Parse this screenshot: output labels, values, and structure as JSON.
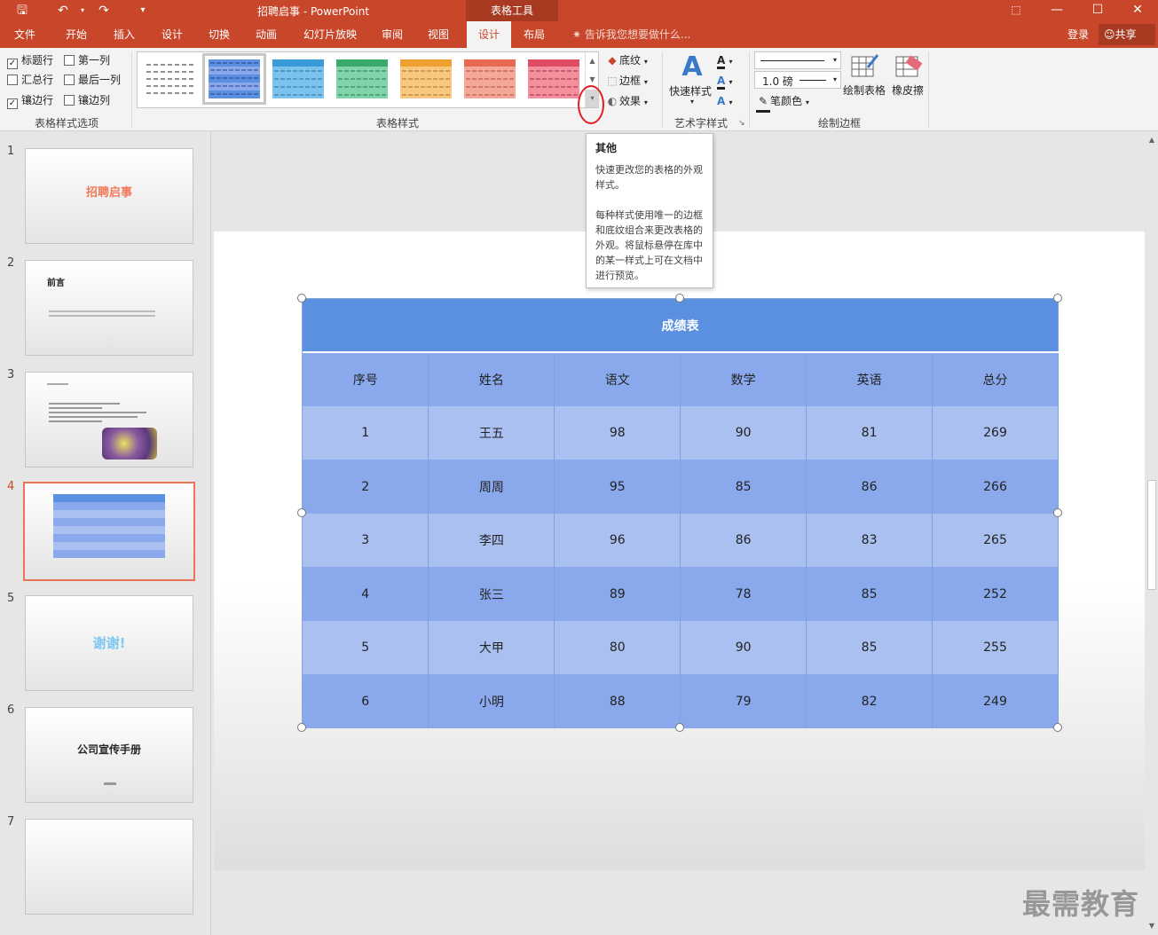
{
  "titlebar": {
    "title": "招聘启事 - PowerPoint",
    "tools_tab": "表格工具"
  },
  "tabs": [
    {
      "label": "文件"
    },
    {
      "label": "开始"
    },
    {
      "label": "插入"
    },
    {
      "label": "设计"
    },
    {
      "label": "切换"
    },
    {
      "label": "动画"
    },
    {
      "label": "幻灯片放映"
    },
    {
      "label": "审阅"
    },
    {
      "label": "视图"
    },
    {
      "label": "设计"
    },
    {
      "label": "布局"
    }
  ],
  "tellme": "告诉我您想要做什么...",
  "account": {
    "login": "登录",
    "share": "共享"
  },
  "ribbon": {
    "options": {
      "header_row": "标题行",
      "first_col": "第一列",
      "total_row": "汇总行",
      "last_col": "最后一列",
      "banded_rows": "镶边行",
      "banded_cols": "镶边列",
      "group_label": "表格样式选项"
    },
    "styles": {
      "shading": "底纹",
      "border": "边框",
      "effects": "效果",
      "group_label": "表格样式",
      "swatch_colors": [
        "#ffffff",
        "#5b8fe0",
        "#5aaee0",
        "#49c08a",
        "#f5a94a",
        "#f0806a",
        "#f06a88"
      ]
    },
    "wordart": {
      "quick_styles": "快速样式",
      "group_label": "艺术字样式"
    },
    "draw": {
      "pen_weight": "1.0 磅",
      "pen_color": "笔颜色",
      "draw_table": "绘制表格",
      "eraser": "橡皮擦",
      "group_label": "绘制边框"
    }
  },
  "tooltip": {
    "title": "其他",
    "p1": "快速更改您的表格的外观样式。",
    "p2": "每种样式使用唯一的边框和底纹组合来更改表格的外观。将鼠标悬停在库中的某一样式上可在文档中进行预览。"
  },
  "thumbnails": [
    {
      "num": "1",
      "text": "招聘启事"
    },
    {
      "num": "2",
      "text": "前言"
    },
    {
      "num": "3",
      "text": ""
    },
    {
      "num": "4",
      "text": ""
    },
    {
      "num": "5",
      "text": "谢谢!"
    },
    {
      "num": "6",
      "text": "公司宣传手册"
    },
    {
      "num": "7",
      "text": ""
    }
  ],
  "table": {
    "title": "成绩表",
    "headers": [
      "序号",
      "姓名",
      "语文",
      "数学",
      "英语",
      "总分"
    ],
    "rows": [
      [
        "1",
        "王五",
        "98",
        "90",
        "81",
        "269"
      ],
      [
        "2",
        "周周",
        "95",
        "85",
        "86",
        "266"
      ],
      [
        "3",
        "李四",
        "96",
        "86",
        "83",
        "265"
      ],
      [
        "4",
        "张三",
        "89",
        "78",
        "85",
        "252"
      ],
      [
        "5",
        "大甲",
        "80",
        "90",
        "85",
        "255"
      ],
      [
        "6",
        "小明",
        "88",
        "79",
        "82",
        "249"
      ]
    ]
  },
  "watermark": "最需教育",
  "colors": {
    "accent": "#c8462a",
    "table_title": "#5b8fe0",
    "table_band_dark": "#89a9ec",
    "table_band_light": "#a9c0f0"
  }
}
